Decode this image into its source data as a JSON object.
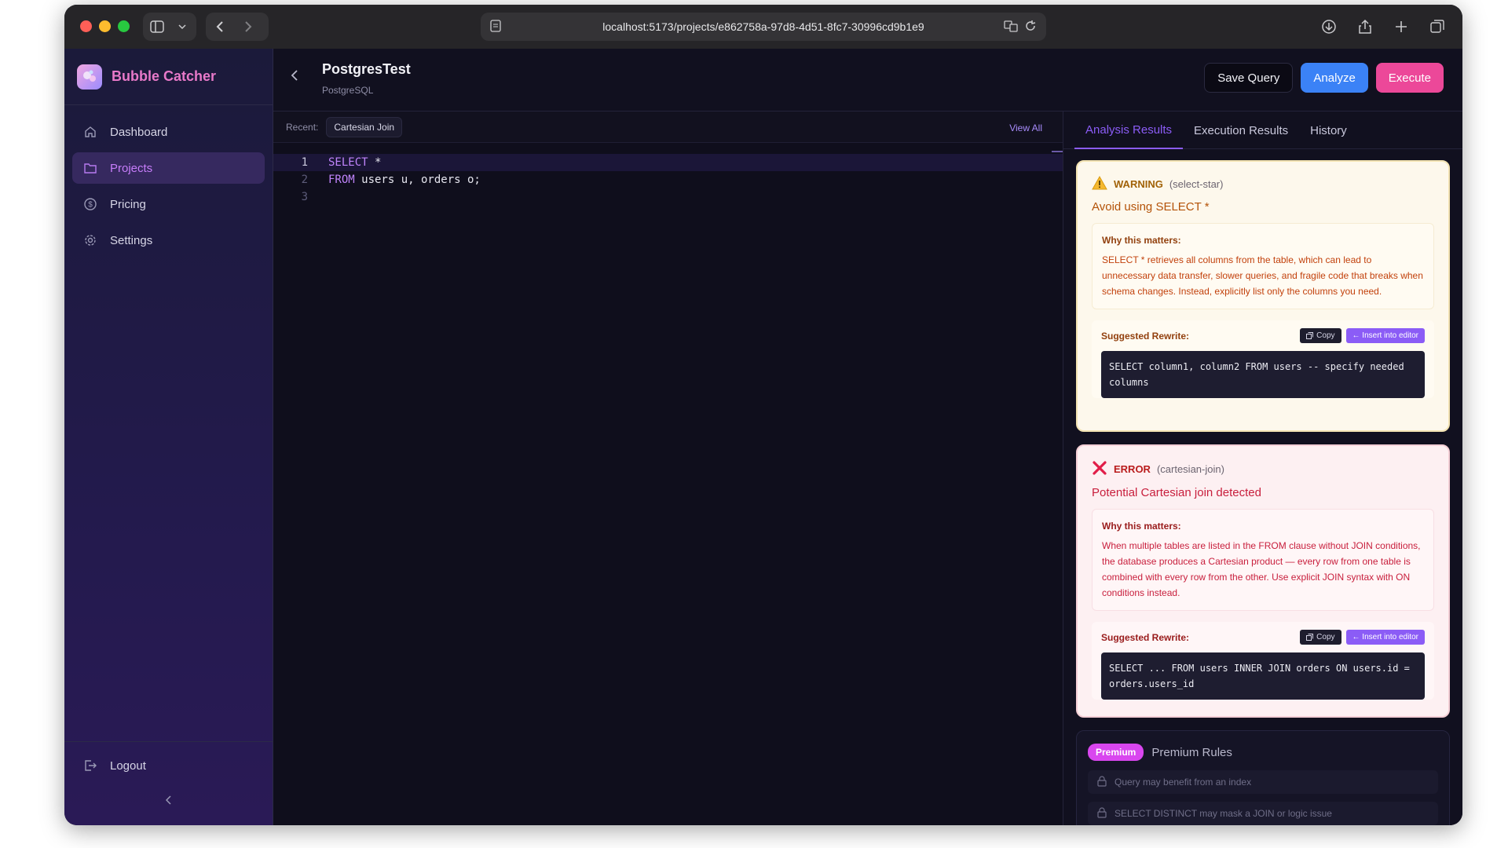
{
  "browser": {
    "url": "localhost:5173/projects/e862758a-97d8-4d51-8fc7-30996cd9b1e9"
  },
  "sidebar": {
    "brand": "Bubble Catcher",
    "items": [
      {
        "label": "Dashboard",
        "icon": "home-icon"
      },
      {
        "label": "Projects",
        "icon": "folder-icon",
        "active": true
      },
      {
        "label": "Pricing",
        "icon": "dollar-icon"
      },
      {
        "label": "Settings",
        "icon": "gear-icon"
      }
    ],
    "logout": "Logout"
  },
  "header": {
    "title": "PostgresTest",
    "subtitle": "PostgreSQL",
    "save_label": "Save Query",
    "analyze_label": "Analyze",
    "execute_label": "Execute"
  },
  "recent": {
    "label": "Recent:",
    "chip": "Cartesian Join",
    "view_all": "View All"
  },
  "editor": {
    "lines": [
      {
        "num": "1",
        "kw": "SELECT",
        "rest": " *"
      },
      {
        "num": "2",
        "kw": "FROM",
        "rest": " users u, orders o;"
      },
      {
        "num": "3",
        "kw": "",
        "rest": ""
      }
    ]
  },
  "tabs": [
    "Analysis Results",
    "Execution Results",
    "History"
  ],
  "results": [
    {
      "severity": "WARNING",
      "rule": "(select-star)",
      "title": "Avoid using SELECT *",
      "why_label": "Why this matters:",
      "why": "SELECT * retrieves all columns from the table, which can lead to unnecessary data transfer, slower queries, and fragile code that breaks when schema changes. Instead, explicitly list only the columns you need.",
      "rewrite_label": "Suggested Rewrite:",
      "copy_label": "Copy",
      "insert_label": "← Insert into editor",
      "rewrite": "SELECT column1, column2 FROM users -- specify needed columns"
    },
    {
      "severity": "ERROR",
      "rule": "(cartesian-join)",
      "title": "Potential Cartesian join detected",
      "why_label": "Why this matters:",
      "why": "When multiple tables are listed in the FROM clause without JOIN conditions, the database produces a Cartesian product — every row from one table is combined with every row from the other. Use explicit JOIN syntax with ON conditions instead.",
      "rewrite_label": "Suggested Rewrite:",
      "copy_label": "Copy",
      "insert_label": "← Insert into editor",
      "rewrite": "SELECT ... FROM users INNER JOIN orders ON users.id = orders.users_id"
    }
  ],
  "premium": {
    "badge": "Premium",
    "title": "Premium Rules",
    "rules": [
      "Query may benefit from an index",
      "SELECT DISTINCT may mask a JOIN or logic issue"
    ]
  },
  "colors": {
    "accent": "#8b5cf6",
    "analyze": "#3b82f6",
    "execute": "#ec4899",
    "brand": "#e879c9"
  }
}
